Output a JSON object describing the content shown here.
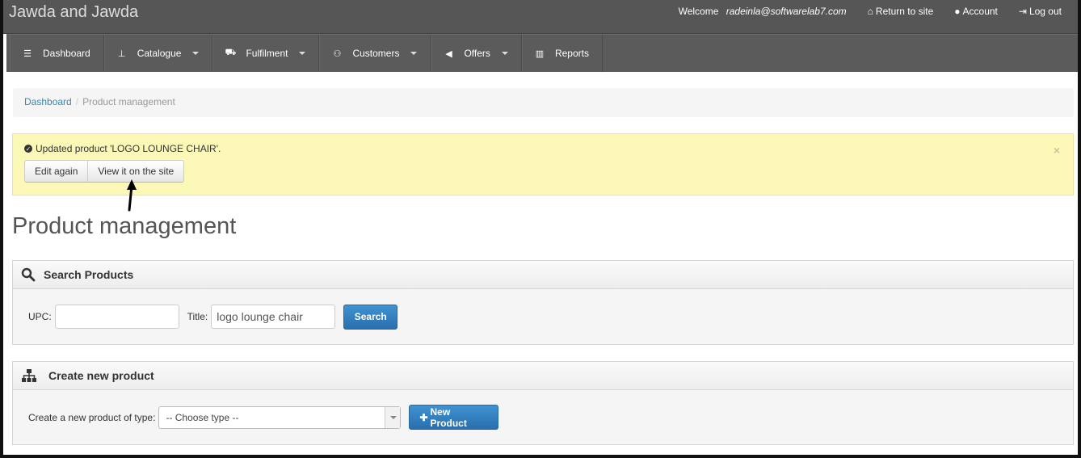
{
  "header": {
    "brand": "Jawda and Jawda",
    "welcome_prefix": "Welcome",
    "welcome_user": "radeinla@softwarelab7.com",
    "return_label": "Return to site",
    "account_label": "Account",
    "logout_label": "Log out"
  },
  "nav": {
    "items": [
      {
        "label": "Dashboard",
        "icon": "list-icon",
        "dropdown": false
      },
      {
        "label": "Catalogue",
        "icon": "sitemap-icon",
        "dropdown": true
      },
      {
        "label": "Fulfilment",
        "icon": "cart-icon",
        "dropdown": true
      },
      {
        "label": "Customers",
        "icon": "group-icon",
        "dropdown": true
      },
      {
        "label": "Offers",
        "icon": "bullhorn-icon",
        "dropdown": true
      },
      {
        "label": "Reports",
        "icon": "bar-chart-icon",
        "dropdown": false
      }
    ]
  },
  "breadcrumb": {
    "home": "Dashboard",
    "current": "Product management"
  },
  "alert": {
    "message": "Updated product 'LOGO LOUNGE CHAIR'.",
    "edit_label": "Edit again",
    "view_label": "View it on the site",
    "close": "×"
  },
  "page": {
    "title": "Product management"
  },
  "search_panel": {
    "title": "Search Products",
    "upc_label": "UPC:",
    "upc_value": "",
    "title_label": "Title:",
    "title_value": "logo lounge chair",
    "search_button": "Search"
  },
  "create_panel": {
    "title": "Create new product",
    "type_label": "Create a new product of type:",
    "type_selected": "-- Choose type --",
    "new_button": "New Product"
  },
  "colors": {
    "topbar": "#565656",
    "alert_bg": "#fcf8b8",
    "primary": "#2f7bbf",
    "link": "#3a87ad"
  }
}
